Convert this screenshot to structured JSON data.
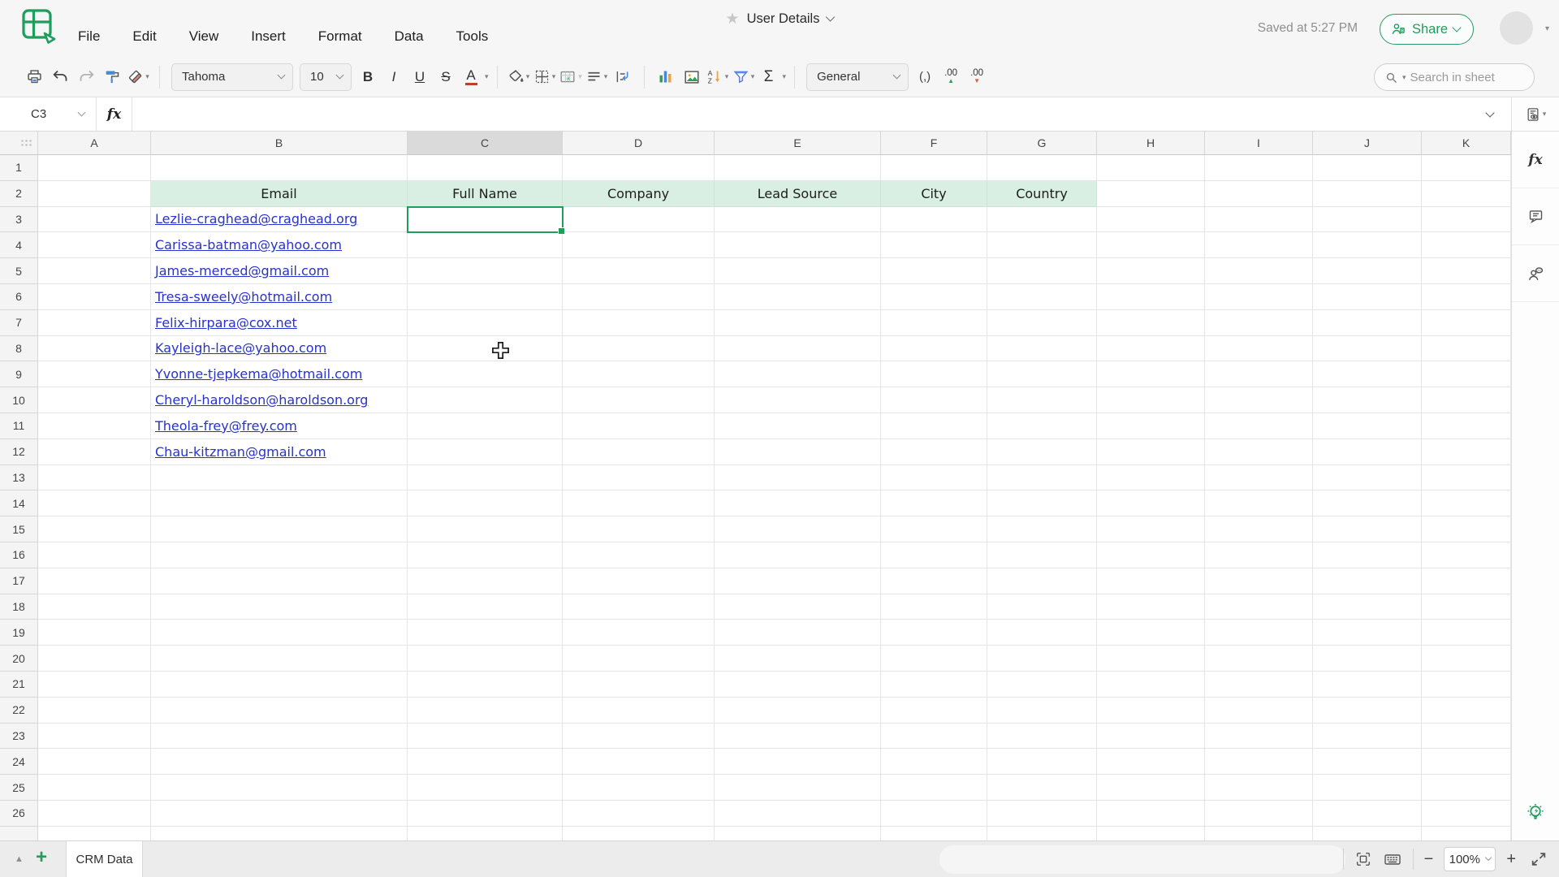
{
  "header": {
    "menus": [
      "File",
      "Edit",
      "View",
      "Insert",
      "Format",
      "Data",
      "Tools"
    ],
    "doc_title": "User Details",
    "saved_status": "Saved at 5:27 PM",
    "share_label": "Share"
  },
  "icons": {
    "dropdown": "▾",
    "star": "★",
    "sheet_list_arrow": "▲",
    "add_sheet": "+",
    "zoom_out": "−",
    "zoom_in": "+",
    "increase_arrow": "▲",
    "decrease_arrow": "▼"
  },
  "toolbar": {
    "font_name": "Tahoma",
    "font_size": "10",
    "bold": "B",
    "italic": "I",
    "underline": "U",
    "strikethrough": "S",
    "font_color": "A",
    "sum": "Σ",
    "comma_format": "(,)",
    "increase_decimal": ".00",
    "decrease_decimal": ".00",
    "number_format": "General",
    "search_placeholder": "Search in sheet"
  },
  "formula_bar": {
    "cell_ref": "C3",
    "fx": "fx",
    "value": ""
  },
  "sheet": {
    "columns": [
      "A",
      "B",
      "C",
      "D",
      "E",
      "F",
      "G",
      "H",
      "I",
      "J",
      "K"
    ],
    "row_count": 26,
    "selected_cell": "C3",
    "header_row": {
      "row": 2,
      "labels": {
        "B": "Email",
        "C": "Full Name",
        "D": "Company",
        "E": "Lead Source",
        "F": "City",
        "G": "Country"
      }
    },
    "emails_column": "B",
    "emails_start_row": 3,
    "emails": [
      "Lezlie-craghead@craghead.org",
      "Carissa-batman@yahoo.com",
      "James-merced@gmail.com",
      "Tresa-sweely@hotmail.com",
      "Felix-hirpara@cox.net",
      "Kayleigh-lace@yahoo.com",
      "Yvonne-tjepkema@hotmail.com",
      "Cheryl-haroldson@haroldson.org",
      "Theola-frey@frey.com",
      "Chau-kitzman@gmail.com"
    ]
  },
  "sidebar": {
    "fx": "fx"
  },
  "footer": {
    "sheet_tab": "CRM Data",
    "zoom_level": "100%"
  },
  "colors": {
    "accent_green": "#1f9d5c",
    "header_row_fill": "#d9efe3",
    "link_blue": "#2832cc",
    "selection_green": "#1e9e5a",
    "font_color_underline": "#c43a2d"
  }
}
